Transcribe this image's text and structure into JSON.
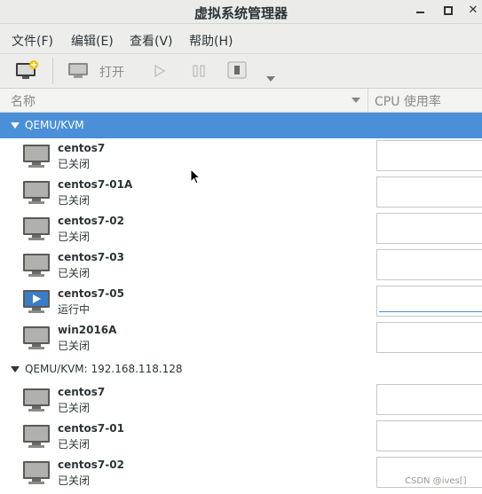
{
  "window": {
    "title": "虚拟系统管理器"
  },
  "menu": {
    "file": "文件(F)",
    "edit": "编辑(E)",
    "view": "查看(V)",
    "help": "帮助(H)"
  },
  "toolbar": {
    "open_label": "打开"
  },
  "columns": {
    "name": "名称",
    "cpu": "CPU 使用率"
  },
  "groups": [
    {
      "label": "QEMU/KVM",
      "vms": [
        {
          "name": "centos7",
          "state": "已关闭",
          "running": false
        },
        {
          "name": "centos7-01A",
          "state": "已关闭",
          "running": false
        },
        {
          "name": "centos7-02",
          "state": "已关闭",
          "running": false
        },
        {
          "name": "centos7-03",
          "state": "已关闭",
          "running": false
        },
        {
          "name": "centos7-05",
          "state": "运行中",
          "running": true
        },
        {
          "name": "win2016A",
          "state": "已关闭",
          "running": false
        }
      ]
    },
    {
      "label": "QEMU/KVM: 192.168.118.128",
      "vms": [
        {
          "name": "centos7",
          "state": "已关闭",
          "running": false
        },
        {
          "name": "centos7-01",
          "state": "已关闭",
          "running": false
        },
        {
          "name": "centos7-02",
          "state": "已关闭",
          "running": false
        }
      ]
    }
  ],
  "watermark": "CSDN @ives[]",
  "colors": {
    "selection": "#4a90d9",
    "running_screen": "#3a7cc7",
    "off_screen": "#b0b0ae"
  }
}
